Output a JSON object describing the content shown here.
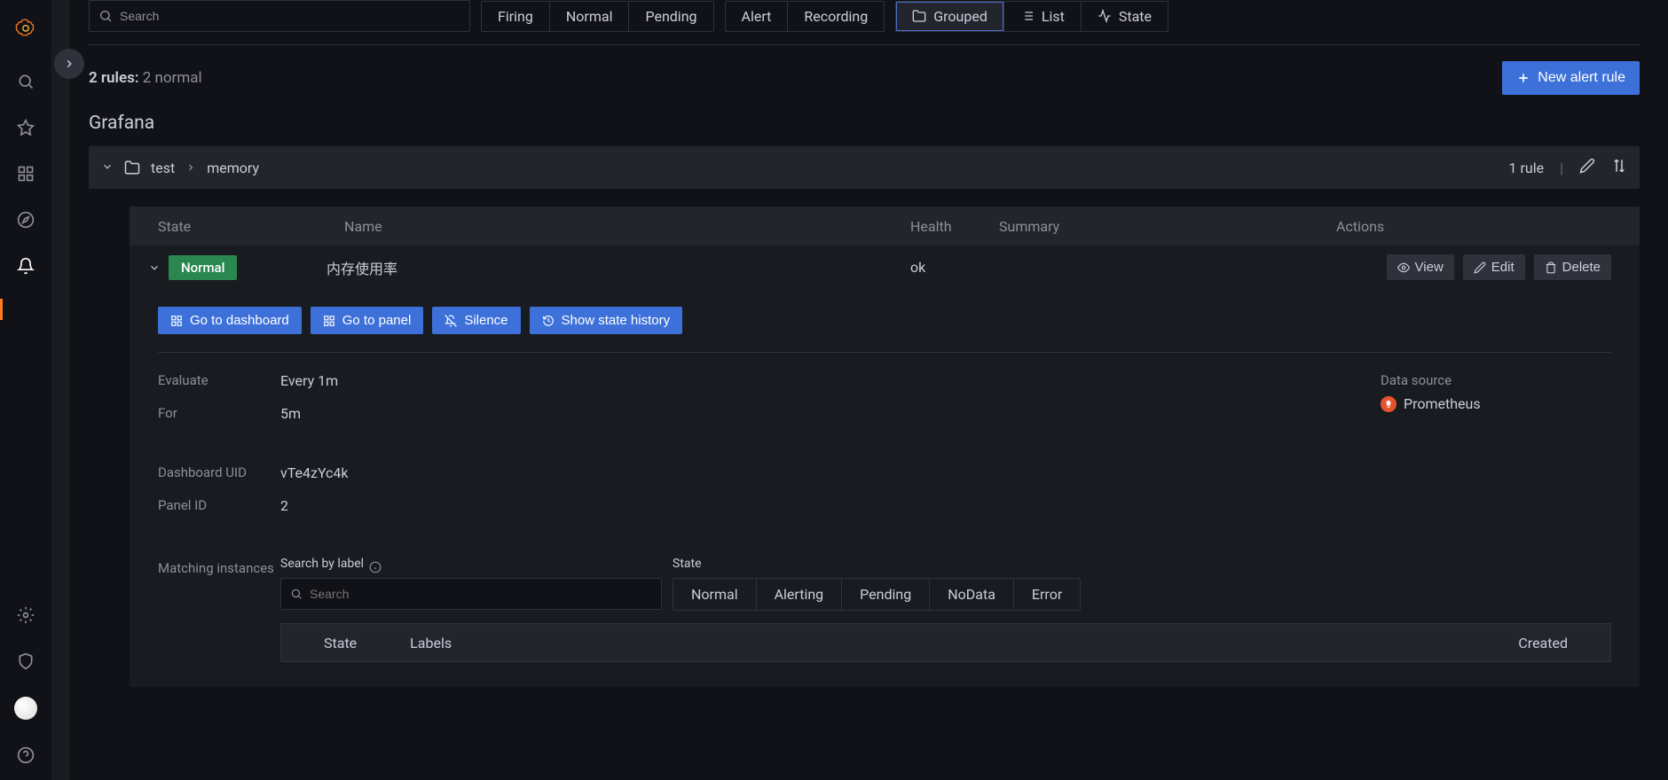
{
  "search": {
    "placeholder": "Search"
  },
  "filters": {
    "firing": "Firing",
    "normal": "Normal",
    "pending": "Pending",
    "alert": "Alert",
    "recording": "Recording"
  },
  "views": {
    "grouped": "Grouped",
    "list": "List",
    "state": "State"
  },
  "summary": {
    "bold": "2 rules:",
    "muted": "2 normal"
  },
  "newRuleBtn": "New alert rule",
  "sectionTitle": "Grafana",
  "group": {
    "namespace": "test",
    "name": "memory",
    "count": "1 rule"
  },
  "columns": {
    "state": "State",
    "name": "Name",
    "health": "Health",
    "summary": "Summary",
    "actions": "Actions"
  },
  "rule": {
    "state": "Normal",
    "name": "内存使用率",
    "health": "ok"
  },
  "rowActions": {
    "view": "View",
    "edit": "Edit",
    "delete": "Delete"
  },
  "expandedActions": {
    "dashboard": "Go to dashboard",
    "panel": "Go to panel",
    "silence": "Silence",
    "history": "Show state history"
  },
  "details": {
    "evaluateLabel": "Evaluate",
    "evaluateValue": "Every 1m",
    "forLabel": "For",
    "forValue": "5m",
    "dashboardUidLabel": "Dashboard UID",
    "dashboardUidValue": "vTe4zYc4k",
    "panelIdLabel": "Panel ID",
    "panelIdValue": "2",
    "dataSourceLabel": "Data source",
    "dataSourceValue": "Prometheus"
  },
  "matching": {
    "label": "Matching instances",
    "searchLabel": "Search by label",
    "searchPlaceholder": "Search",
    "stateLabel": "State",
    "states": {
      "normal": "Normal",
      "alerting": "Alerting",
      "pending": "Pending",
      "nodata": "NoData",
      "error": "Error"
    },
    "tableHead": {
      "state": "State",
      "labels": "Labels",
      "created": "Created"
    }
  }
}
